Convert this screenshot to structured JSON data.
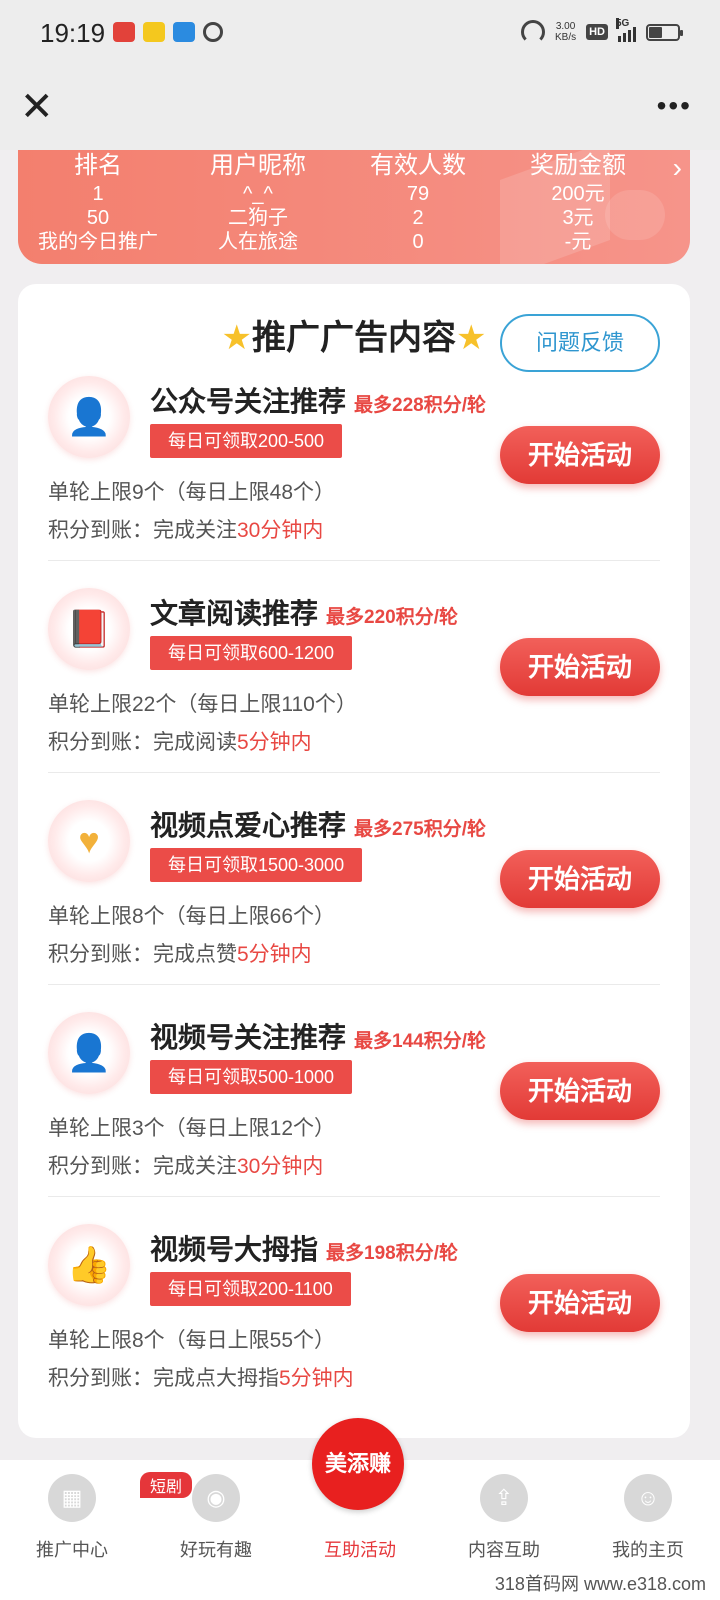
{
  "status_bar": {
    "time": "19:19",
    "net_speed": "3.00",
    "net_unit": "KB/s",
    "hd": "HD",
    "network": "5G"
  },
  "header": {
    "close_icon": "close-icon",
    "more_icon": "more-icon"
  },
  "ranking": {
    "headers": [
      "排名",
      "用户昵称",
      "有效人数",
      "奖励金额"
    ],
    "rows": [
      [
        "1",
        "^_^",
        "79",
        "200元"
      ],
      [
        "50",
        "二狗子",
        "2",
        "3元"
      ],
      [
        "我的今日推广",
        "人在旅途",
        "0",
        "-元"
      ]
    ]
  },
  "card": {
    "title": "推广广告内容",
    "feedback_label": "问题反馈",
    "tasks": [
      {
        "name": "公众号关注推荐",
        "max": "最多228积分/轮",
        "daily": "每日可领取200-500",
        "limit": "单轮上限9个（每日上限48个）",
        "credit_prefix": "积分到账：完成关注",
        "credit_time": "30分钟内",
        "button": "开始活动",
        "icon": "user-star-icon"
      },
      {
        "name": "文章阅读推荐",
        "max": "最多220积分/轮",
        "daily": "每日可领取600-1200",
        "limit": "单轮上限22个（每日上限110个）",
        "credit_prefix": "积分到账：完成阅读",
        "credit_time": "5分钟内",
        "button": "开始活动",
        "icon": "book-icon"
      },
      {
        "name": "视频点爱心推荐",
        "max": "最多275积分/轮",
        "daily": "每日可领取1500-3000",
        "limit": "单轮上限8个（每日上限66个）",
        "credit_prefix": "积分到账：完成点赞",
        "credit_time": "5分钟内",
        "button": "开始活动",
        "icon": "heart-icon"
      },
      {
        "name": "视频号关注推荐",
        "max": "最多144积分/轮",
        "daily": "每日可领取500-1000",
        "limit": "单轮上限3个（每日上限12个）",
        "credit_prefix": "积分到账：完成关注",
        "credit_time": "30分钟内",
        "button": "开始活动",
        "icon": "user-flower-icon"
      },
      {
        "name": "视频号大拇指",
        "max": "最多198积分/轮",
        "daily": "每日可领取200-1100",
        "limit": "单轮上限8个（每日上限55个）",
        "credit_prefix": "积分到账：完成点大拇指",
        "credit_time": "5分钟内",
        "button": "开始活动",
        "icon": "thumbs-up-icon"
      }
    ]
  },
  "bottom_nav": {
    "items": [
      {
        "label": "推广中心",
        "icon": "grid-icon"
      },
      {
        "label": "好玩有趣",
        "icon": "planet-icon",
        "badge": "短剧"
      },
      {
        "label": "互助活动",
        "icon": "logo-icon",
        "logo_text": "美添赚"
      },
      {
        "label": "内容互助",
        "icon": "upload-doc-icon"
      },
      {
        "label": "我的主页",
        "icon": "profile-icon"
      }
    ],
    "watermark": "318首码网 www.e318.com"
  },
  "colors": {
    "accent": "#e5363a",
    "banner": "#f37f6e",
    "feedback": "#2f96cf"
  }
}
